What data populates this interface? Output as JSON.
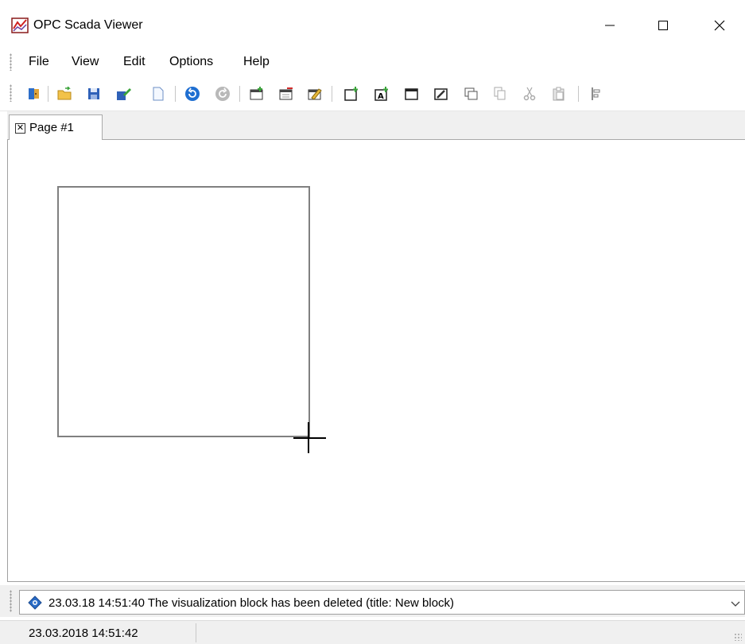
{
  "window": {
    "title": "OPC Scada Viewer",
    "controls": [
      "minimize",
      "maximize",
      "close"
    ]
  },
  "menu": {
    "items": [
      {
        "label": "File"
      },
      {
        "label": "View"
      },
      {
        "label": "Edit"
      },
      {
        "label": "Options"
      },
      {
        "label": "Help"
      }
    ]
  },
  "toolbar": {
    "buttons": [
      {
        "icon": "exit-door-icon"
      },
      {
        "icon": "open-folder-icon"
      },
      {
        "icon": "save-icon"
      },
      {
        "icon": "save-as-icon"
      },
      {
        "icon": "new-page-icon"
      },
      {
        "icon": "undo-icon"
      },
      {
        "icon": "redo-icon"
      },
      {
        "icon": "add-page-icon"
      },
      {
        "icon": "delete-page-icon"
      },
      {
        "icon": "edit-page-icon"
      },
      {
        "icon": "add-block-icon"
      },
      {
        "icon": "add-text-block-icon"
      },
      {
        "icon": "block-icon"
      },
      {
        "icon": "edit-block-icon"
      },
      {
        "icon": "copy-block-icon"
      },
      {
        "icon": "copy-icon"
      },
      {
        "icon": "cut-icon"
      },
      {
        "icon": "paste-icon"
      },
      {
        "icon": "align-icon"
      }
    ]
  },
  "tabs": [
    {
      "label": "Page #1",
      "close_glyph": "✕"
    }
  ],
  "log": {
    "message": "23.03.18 14:51:40 The visualization block has been deleted (title: New block)"
  },
  "status": {
    "datetime": "23.03.2018 14:51:42"
  },
  "colors": {
    "block_border": "#808080",
    "tab_border": "#a9a9a9",
    "bar_background": "#f0f0f0"
  }
}
